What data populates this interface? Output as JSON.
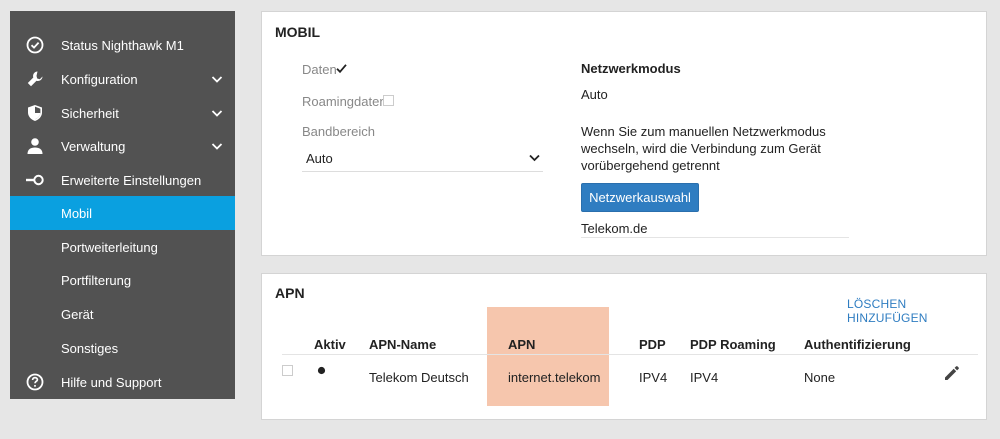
{
  "sidebar": {
    "items": [
      {
        "label": "Status Nighthawk M1",
        "icon": "check-circle-icon",
        "chevron": false,
        "active": false
      },
      {
        "label": "Konfiguration",
        "icon": "wrench-icon",
        "chevron": true,
        "active": false
      },
      {
        "label": "Sicherheit",
        "icon": "shield-icon",
        "chevron": true,
        "active": false
      },
      {
        "label": "Verwaltung",
        "icon": "person-icon",
        "chevron": true,
        "active": false
      },
      {
        "label": "Erweiterte Einstellungen",
        "icon": "key-icon",
        "chevron": false,
        "active": false
      },
      {
        "label": "Mobil",
        "icon": "",
        "chevron": false,
        "active": true
      },
      {
        "label": "Portweiterleitung",
        "icon": "",
        "chevron": false,
        "active": false
      },
      {
        "label": "Portfilterung",
        "icon": "",
        "chevron": false,
        "active": false
      },
      {
        "label": "Gerät",
        "icon": "",
        "chevron": false,
        "active": false
      },
      {
        "label": "Sonstiges",
        "icon": "",
        "chevron": false,
        "active": false
      },
      {
        "label": "Hilfe und Support",
        "icon": "help-circle-icon",
        "chevron": false,
        "active": false
      }
    ],
    "active_color": "#0aa0e0"
  },
  "mobil": {
    "title": "MOBIL",
    "data_label": "Daten",
    "data_checked": true,
    "roaming_label": "Roamingdaten",
    "roaming_checked": false,
    "band_label": "Bandbereich",
    "band_value": "Auto",
    "network_mode_title": "Netzwerkmodus",
    "network_mode_value": "Auto",
    "info_line1": "Wenn Sie zum manuellen Netzwerkmodus",
    "info_line2": "wechseln, wird die Verbindung zum Gerät",
    "info_line3": "vorübergehend getrennt",
    "network_select_button": "Netzwerkauswahl",
    "carrier": "Telekom.de"
  },
  "apn": {
    "title": "APN",
    "actions_label": "LÖSCHEN HINZUFÜGEN",
    "columns": [
      "Aktiv",
      "APN-Name",
      "APN",
      "PDP",
      "PDP Roaming",
      "Authentifizierung"
    ],
    "rows": [
      {
        "active": true,
        "name": "Telekom Deutsch",
        "apn": "internet.telekom",
        "pdp": "IPV4",
        "pdp_roaming": "IPV4",
        "auth": "None"
      }
    ],
    "highlight_color": "#f6c6ad"
  }
}
